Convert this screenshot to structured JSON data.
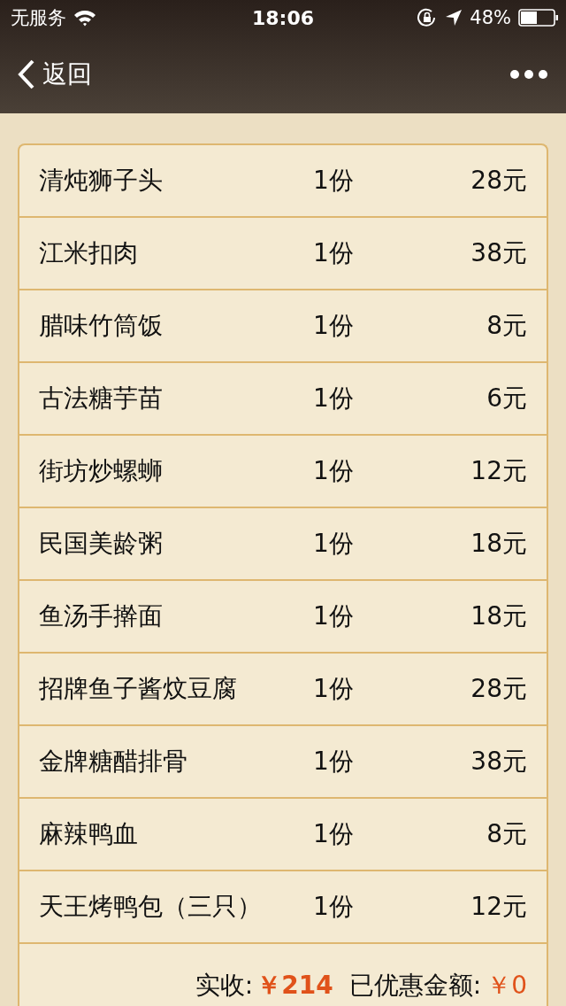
{
  "status_bar": {
    "carrier": "无服务",
    "time": "18:06",
    "battery_percent": "48%"
  },
  "nav": {
    "back": "返回"
  },
  "items": [
    {
      "name": "清炖狮子头",
      "qty": "1份",
      "price": "28元"
    },
    {
      "name": "江米扣肉",
      "qty": "1份",
      "price": "38元"
    },
    {
      "name": "腊味竹筒饭",
      "qty": "1份",
      "price": "8元"
    },
    {
      "name": "古法糖芋苗",
      "qty": "1份",
      "price": "6元"
    },
    {
      "name": "街坊炒螺蛳",
      "qty": "1份",
      "price": "12元"
    },
    {
      "name": "民国美龄粥",
      "qty": "1份",
      "price": "18元"
    },
    {
      "name": "鱼汤手擀面",
      "qty": "1份",
      "price": "18元"
    },
    {
      "name": "招牌鱼子酱炆豆腐",
      "qty": "1份",
      "price": "28元"
    },
    {
      "name": "金牌糖醋排骨",
      "qty": "1份",
      "price": "38元"
    },
    {
      "name": "麻辣鸭血",
      "qty": "1份",
      "price": "8元"
    },
    {
      "name": "天王烤鸭包（三只）",
      "qty": "1份",
      "price": "12元"
    }
  ],
  "summary": {
    "paid_label": "实收:",
    "paid_amount": "￥214",
    "discount_label": "已优惠金额:",
    "discount_amount": "￥0"
  }
}
